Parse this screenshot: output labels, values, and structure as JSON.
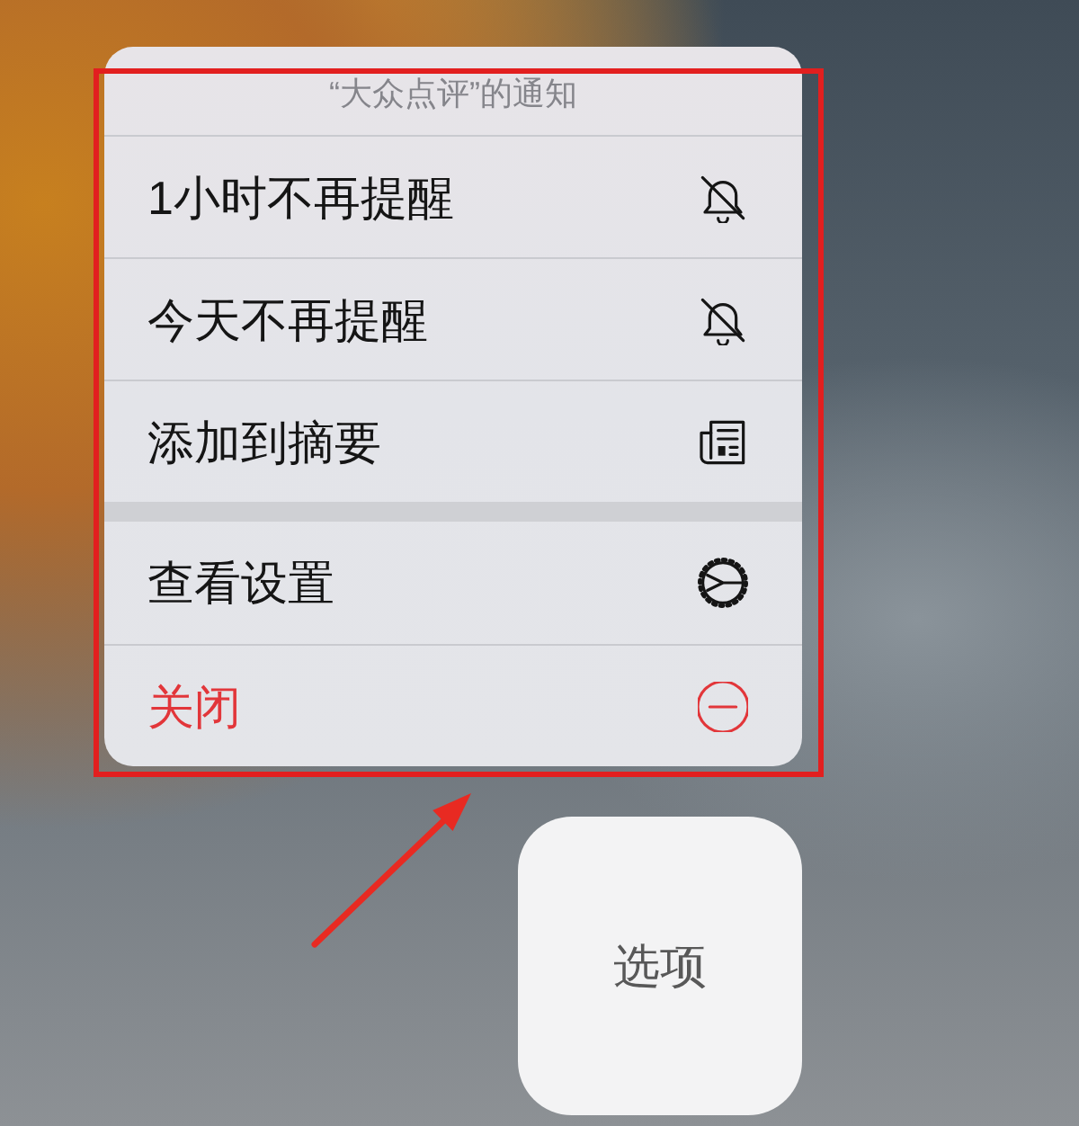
{
  "menu": {
    "title": "“大众点评”的通知",
    "sections": [
      {
        "items": [
          {
            "label": "1小时不再提醒",
            "kind": "mute"
          },
          {
            "label": "今天不再提醒",
            "kind": "mute"
          },
          {
            "label": "添加到摘要",
            "kind": "summary"
          }
        ]
      },
      {
        "items": [
          {
            "label": "查看设置",
            "kind": "settings"
          },
          {
            "label": "关闭",
            "kind": "destructive"
          }
        ]
      }
    ]
  },
  "options_button": {
    "label": "选项"
  }
}
